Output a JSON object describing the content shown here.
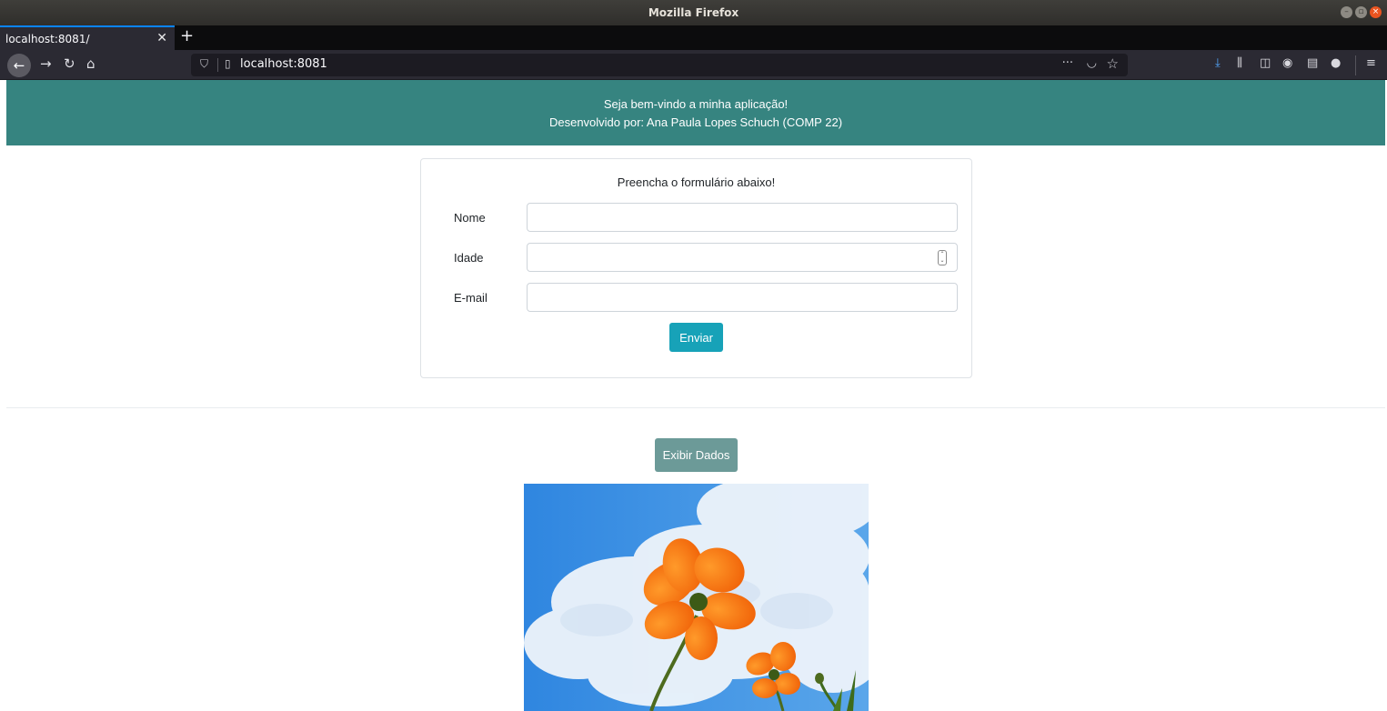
{
  "window": {
    "title": "Mozilla Firefox"
  },
  "tab": {
    "title": "localhost:8081/"
  },
  "browser": {
    "url": "localhost:8081"
  },
  "header": {
    "line1": "Seja bem-vindo a minha aplicação!",
    "line2": "Desenvolvido por: Ana Paula Lopes Schuch (COMP 22)"
  },
  "form": {
    "title": "Preencha o formulário abaixo!",
    "fields": [
      {
        "label": "Nome",
        "value": ""
      },
      {
        "label": "Idade",
        "value": ""
      },
      {
        "label": "E-mail",
        "value": ""
      }
    ],
    "submit_label": "Enviar"
  },
  "show_button_label": "Exibir Dados",
  "colors": {
    "header": "#368480",
    "submit": "#17a2b8",
    "show_button": "#6c9a98"
  }
}
